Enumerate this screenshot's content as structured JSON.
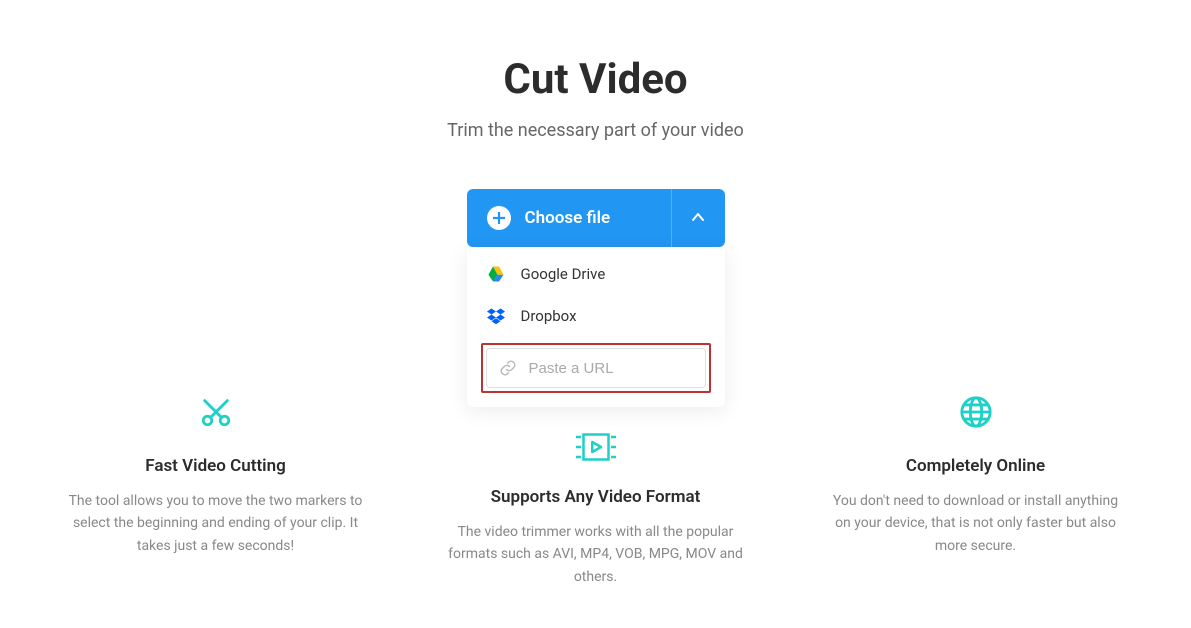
{
  "header": {
    "title": "Cut Video",
    "subtitle": "Trim the necessary part of your video"
  },
  "upload": {
    "button_label": "Choose file",
    "dropdown_items": [
      {
        "label": "Google Drive",
        "icon": "google-drive"
      },
      {
        "label": "Dropbox",
        "icon": "dropbox"
      }
    ],
    "url_placeholder": "Paste a URL"
  },
  "features": [
    {
      "title": "Fast Video Cutting",
      "description": "The tool allows you to move the two markers to select the beginning and ending of your clip. It takes just a few seconds!",
      "icon": "scissors"
    },
    {
      "title": "Supports Any Video Format",
      "description": "The video trimmer works with all the popular formats such as AVI, MP4, VOB, MPG, MOV and others.",
      "icon": "play-reel"
    },
    {
      "title": "Completely Online",
      "description": "You don't need to download or install anything on your device, that is not only faster but also more secure.",
      "icon": "globe"
    }
  ]
}
